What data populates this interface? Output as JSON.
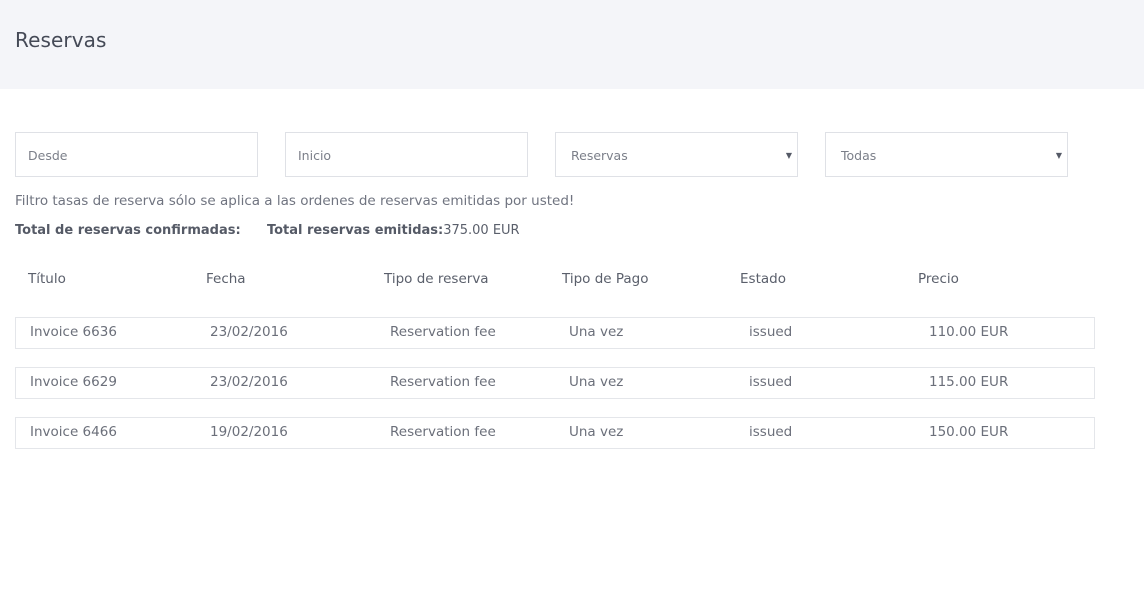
{
  "header": {
    "title": "Reservas"
  },
  "filters": {
    "from_placeholder": "Desde",
    "start_placeholder": "Inicio",
    "type_select": "Reservas",
    "status_select": "Todas"
  },
  "notice": "Filtro tasas de reserva sólo se aplica a las ordenes de reservas emitidas por usted!",
  "totals": {
    "confirmed_label": "Total de reservas confirmadas:",
    "confirmed_value": "",
    "issued_label": "Total reservas emitidas:",
    "issued_value": "375.00 EUR"
  },
  "table": {
    "columns": [
      "Título",
      "Fecha",
      "Tipo de reserva",
      "Tipo de Pago",
      "Estado",
      "Precio"
    ],
    "rows": [
      [
        "Invoice 6636",
        "23/02/2016",
        "Reservation fee",
        "Una vez",
        "issued",
        "110.00 EUR"
      ],
      [
        "Invoice 6629",
        "23/02/2016",
        "Reservation fee",
        "Una vez",
        "issued",
        "115.00 EUR"
      ],
      [
        "Invoice 6466",
        "19/02/2016",
        "Reservation fee",
        "Una vez",
        "issued",
        "150.00 EUR"
      ]
    ]
  }
}
